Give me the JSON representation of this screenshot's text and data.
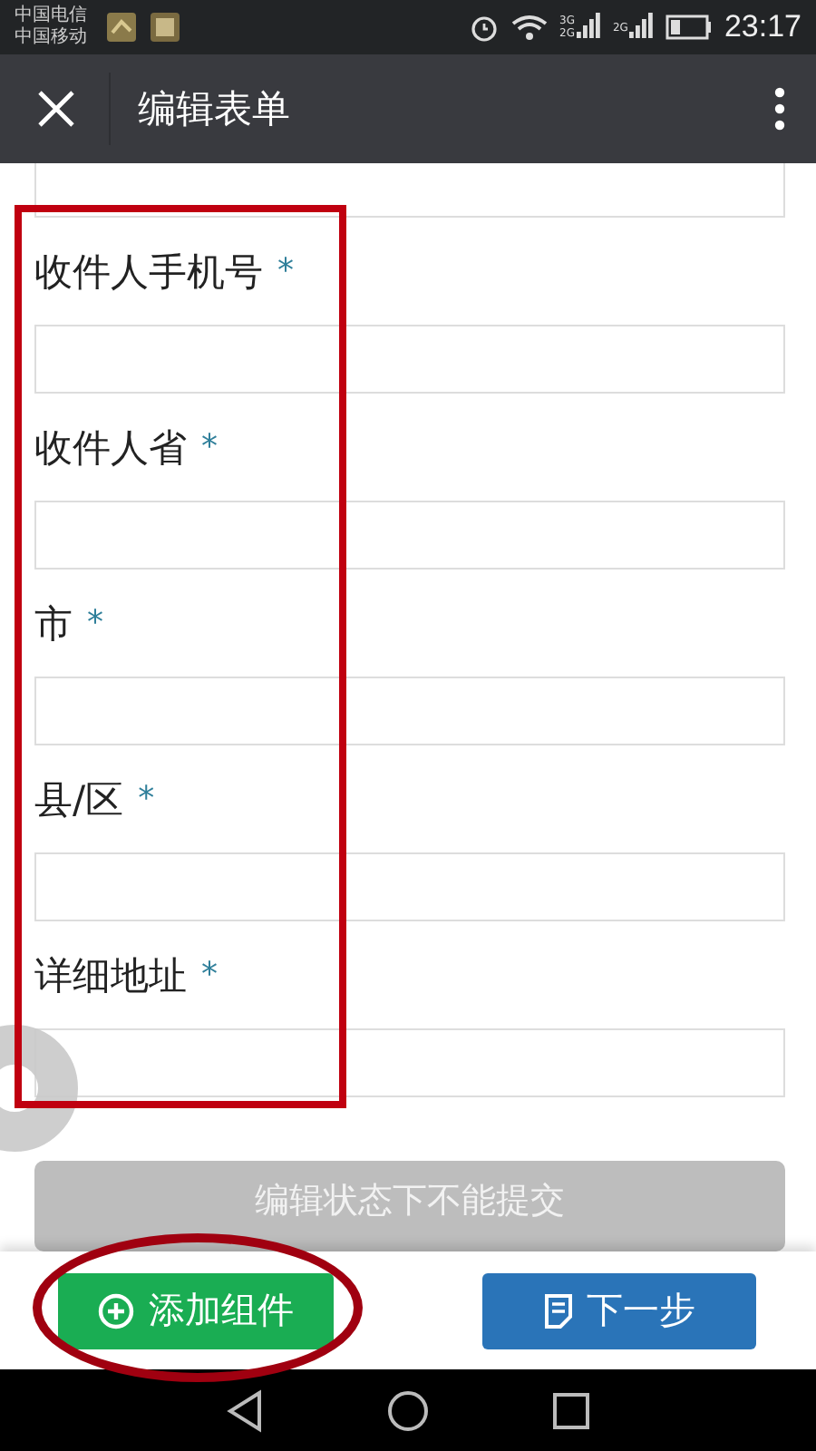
{
  "status_bar": {
    "carriers": [
      "中国电信",
      "中国移动"
    ],
    "network_labels": [
      "3G",
      "2G",
      "2G"
    ],
    "time": "23:17"
  },
  "app_bar": {
    "title": "编辑表单"
  },
  "fields": [
    {
      "label": "收件人手机号",
      "required_mark": "*"
    },
    {
      "label": "收件人省",
      "required_mark": "*"
    },
    {
      "label": "市",
      "required_mark": "*"
    },
    {
      "label": "县/区",
      "required_mark": "*"
    },
    {
      "label": "详细地址",
      "required_mark": "*"
    }
  ],
  "submit_button": {
    "label": "编辑状态下不能提交",
    "disabled": true
  },
  "bottom_bar": {
    "buttons": [
      {
        "kind": "add",
        "label": "添加组件"
      },
      {
        "kind": "next",
        "label": "下一步"
      }
    ]
  }
}
